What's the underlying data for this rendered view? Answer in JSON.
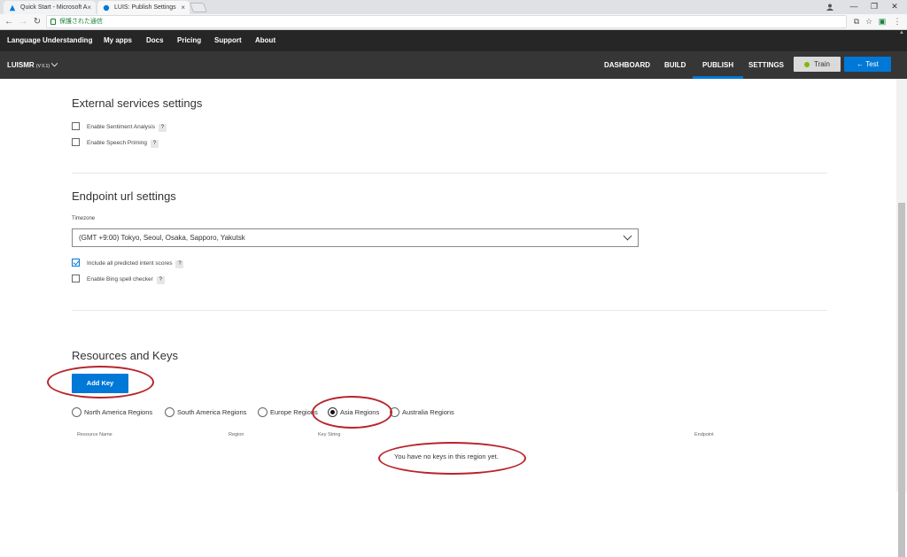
{
  "browser": {
    "tabs": [
      {
        "title": "Quick Start - Microsoft A",
        "close": "×"
      },
      {
        "title": "LUIS: Publish Settings",
        "close": "×"
      }
    ],
    "address": "保護された通信",
    "controls": {
      "minimize": "—",
      "restore": "❐",
      "close": "✕"
    }
  },
  "topnav": {
    "brand": "Language Understanding",
    "items": [
      "My apps",
      "Docs",
      "Pricing",
      "Support",
      "About"
    ]
  },
  "app": {
    "name": "LUISMR",
    "version": "(V 0.1)",
    "tabs": [
      "DASHBOARD",
      "BUILD",
      "PUBLISH",
      "SETTINGS"
    ],
    "active_tab": "PUBLISH",
    "train_label": "Train",
    "test_label": "Test"
  },
  "external": {
    "heading": "External services settings",
    "options": [
      {
        "label": "Enable Sentiment Analysis",
        "checked": false
      },
      {
        "label": "Enable Speech Priming",
        "checked": false
      }
    ]
  },
  "endpoint": {
    "heading": "Endpoint url settings",
    "timezone_label": "Timezone",
    "timezone_value": "(GMT +9:00) Tokyo, Seoul, Osaka, Sapporo, Yakutsk",
    "options": [
      {
        "label": "Include all predicted intent scores",
        "checked": true
      },
      {
        "label": "Enable Bing spell checker",
        "checked": false
      }
    ]
  },
  "resources": {
    "heading": "Resources and Keys",
    "add_key_label": "Add Key",
    "regions": [
      "North America Regions",
      "South America Regions",
      "Europe Regions",
      "Asia Regions",
      "Australia Regions"
    ],
    "selected_region": "Asia Regions",
    "columns": [
      "Resource Name",
      "Region",
      "Key String",
      "Endpoint"
    ],
    "empty_message": "You have no keys in this region yet."
  },
  "help_glyph": "?",
  "colors": {
    "accent": "#0078d7",
    "annotation": "#b8242a",
    "nav_bg": "#262626",
    "subnav_bg": "#363636"
  }
}
